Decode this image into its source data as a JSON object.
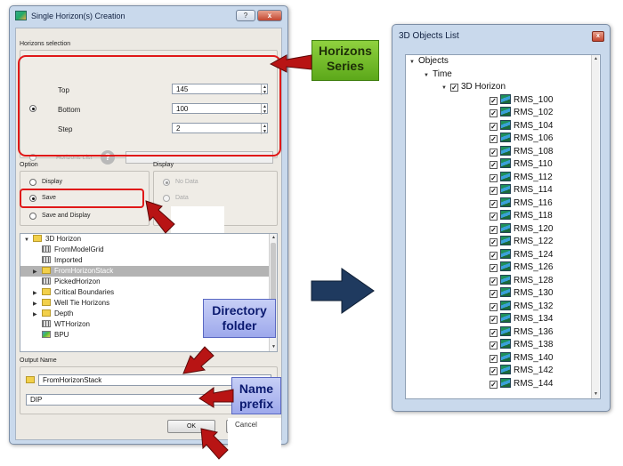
{
  "dialog": {
    "title": "Single Horizon(s) Creation",
    "help_button": "?",
    "close_button": "x",
    "horizons_selection": {
      "group_label": "Horizons selection",
      "top_label": "Top",
      "top_value": "145",
      "bottom_label": "Bottom",
      "bottom_value": "100",
      "step_label": "Step",
      "step_value": "2",
      "horizons_list_label": "Horizons List",
      "horizons_list_value": ""
    },
    "option": {
      "group_label": "Option",
      "items": [
        "Display",
        "Save",
        "Save and Display"
      ],
      "selected": "Save"
    },
    "display": {
      "group_label": "Display",
      "items": [
        "No Data",
        "Data"
      ],
      "selected": "No Data"
    },
    "tree": {
      "root": "3D Horizon",
      "items": [
        {
          "label": "FromModelGrid",
          "icon": "grid"
        },
        {
          "label": "Imported",
          "icon": "grid"
        },
        {
          "label": "FromHorizonStack",
          "icon": "folder",
          "selected": true
        },
        {
          "label": "PickedHorizon",
          "icon": "grid"
        },
        {
          "label": "Critical Boundaries",
          "icon": "folder"
        },
        {
          "label": "Well Tie Horizons",
          "icon": "folder"
        },
        {
          "label": "Depth",
          "icon": "folder"
        },
        {
          "label": "WTHorizon",
          "icon": "grid"
        },
        {
          "label": "BPU",
          "icon": "surface"
        }
      ]
    },
    "output": {
      "group_label": "Output Name",
      "folder_value": "FromHorizonStack",
      "prefix_value": "DIP"
    },
    "ok_label": "OK",
    "cancel_label": "Cancel"
  },
  "callouts": {
    "horizons_series": [
      "Horizons",
      "Series"
    ],
    "directory_folder": [
      "Directory",
      "folder"
    ],
    "name_prefix": [
      "Name",
      "prefix"
    ]
  },
  "objects_panel": {
    "title": "3D Objects List",
    "close_button": "x",
    "root": "Objects",
    "time": "Time",
    "horizon": "3D Horizon",
    "items": [
      "RMS_100",
      "RMS_102",
      "RMS_104",
      "RMS_106",
      "RMS_108",
      "RMS_110",
      "RMS_112",
      "RMS_114",
      "RMS_116",
      "RMS_118",
      "RMS_120",
      "RMS_122",
      "RMS_124",
      "RMS_126",
      "RMS_128",
      "RMS_130",
      "RMS_132",
      "RMS_134",
      "RMS_136",
      "RMS_138",
      "RMS_140",
      "RMS_142",
      "RMS_144"
    ]
  },
  "colors": {
    "highlight": "#e01818",
    "arrow": "#b81414",
    "green_callout": "#7bbf30",
    "blue_callout": "#aab3ef",
    "big_arrow": "#1f3a5f"
  }
}
